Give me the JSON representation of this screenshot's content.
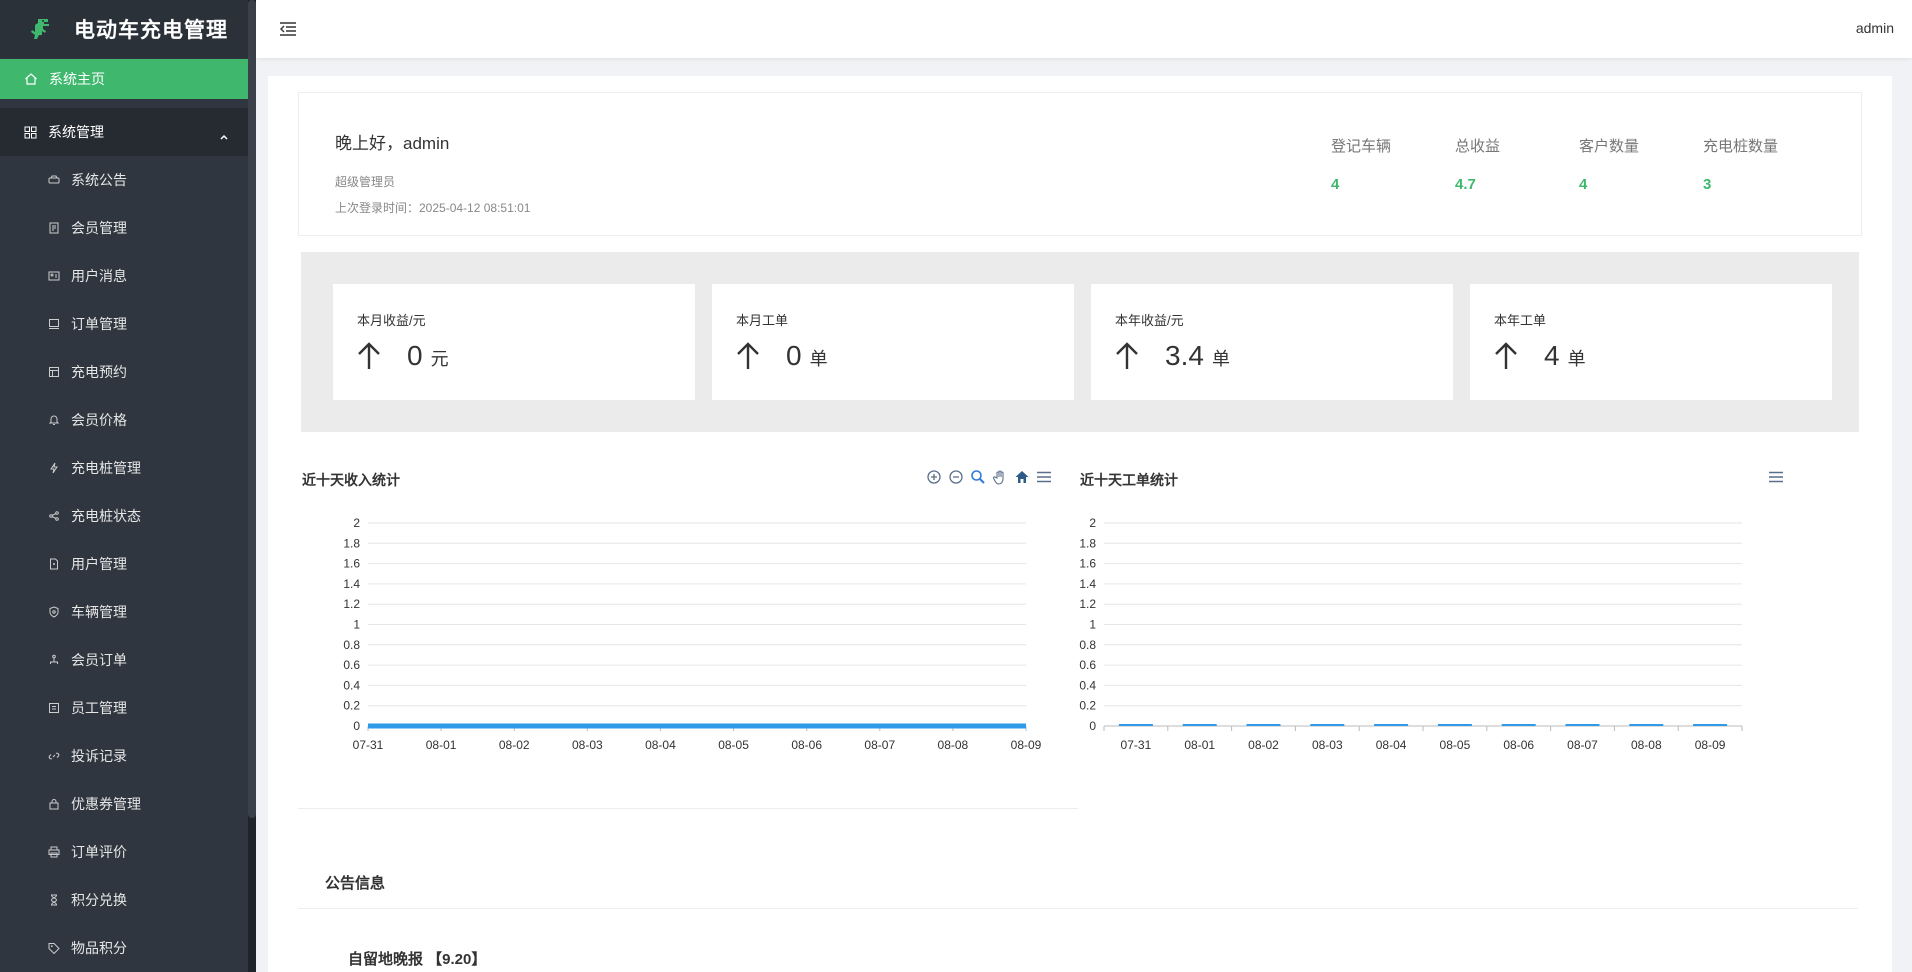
{
  "app": {
    "title": "电动车充电管理",
    "logo_icon": "dinosaur-logo-icon",
    "accent_color": "#3fb86e"
  },
  "sidebar": {
    "home": {
      "label": "系统主页",
      "icon": "home-icon"
    },
    "group": {
      "label": "系统管理",
      "icon": "grid-icon"
    },
    "items": [
      {
        "label": "系统公告",
        "icon": "car-icon"
      },
      {
        "label": "会员管理",
        "icon": "document-icon"
      },
      {
        "label": "用户消息",
        "icon": "id-card-icon"
      },
      {
        "label": "订单管理",
        "icon": "monitor-icon"
      },
      {
        "label": "充电预约",
        "icon": "layout-icon"
      },
      {
        "label": "会员价格",
        "icon": "bell-icon"
      },
      {
        "label": "充电桩管理",
        "icon": "lightning-icon"
      },
      {
        "label": "充电桩状态",
        "icon": "share-icon"
      },
      {
        "label": "用户管理",
        "icon": "file-icon"
      },
      {
        "label": "车辆管理",
        "icon": "shield-icon"
      },
      {
        "label": "会员订单",
        "icon": "network-icon"
      },
      {
        "label": "员工管理",
        "icon": "report-icon"
      },
      {
        "label": "投诉记录",
        "icon": "link-icon"
      },
      {
        "label": "优惠券管理",
        "icon": "lock-icon"
      },
      {
        "label": "订单评价",
        "icon": "printer-icon"
      },
      {
        "label": "积分兑换",
        "icon": "hourglass-icon"
      },
      {
        "label": "物品积分",
        "icon": "tag-icon"
      }
    ]
  },
  "header": {
    "menu_icon": "menu-toggle-icon",
    "user": "admin"
  },
  "welcome": {
    "greeting": "晚上好，admin",
    "role": "超级管理员",
    "last_login": "上次登录时间：2025-04-12 08:51:01",
    "stats": [
      {
        "label": "登记车辆",
        "value": "4"
      },
      {
        "label": "总收益",
        "value": "4.7"
      },
      {
        "label": "客户数量",
        "value": "4"
      },
      {
        "label": "充电桩数量",
        "value": "3"
      }
    ]
  },
  "cards": [
    {
      "label": "本月收益/元",
      "value": "0",
      "unit": "元"
    },
    {
      "label": "本月工单",
      "value": "0",
      "unit": "单"
    },
    {
      "label": "本年收益/元",
      "value": "3.4",
      "unit": "单"
    },
    {
      "label": "本年工单",
      "value": "4",
      "unit": "单"
    }
  ],
  "chart_data": [
    {
      "type": "area",
      "title": "近十天收入统计",
      "categories": [
        "07-31",
        "08-01",
        "08-02",
        "08-03",
        "08-04",
        "08-05",
        "08-06",
        "08-07",
        "08-08",
        "08-09"
      ],
      "values": [
        0,
        0,
        0,
        0,
        0,
        0,
        0,
        0,
        0,
        0
      ],
      "ylim": [
        0,
        2
      ],
      "yticks": [
        "0",
        "0.2",
        "0.4",
        "0.6",
        "0.8",
        "1",
        "1.2",
        "1.4",
        "1.6",
        "1.8",
        "2"
      ],
      "grid": true,
      "color": "#2f9be8",
      "tools": [
        "zoom-in-icon",
        "zoom-out-icon",
        "magnifier-icon",
        "hand-pan-icon",
        "home-reset-icon",
        "hamburger-menu-icon"
      ]
    },
    {
      "type": "bar",
      "title": "近十天工单统计",
      "categories": [
        "07-31",
        "08-01",
        "08-02",
        "08-03",
        "08-04",
        "08-05",
        "08-06",
        "08-07",
        "08-08",
        "08-09"
      ],
      "values": [
        0,
        0,
        0,
        0,
        0,
        0,
        0,
        0,
        0,
        0
      ],
      "ylim": [
        0,
        2
      ],
      "yticks": [
        "0",
        "0.2",
        "0.4",
        "0.6",
        "0.8",
        "1",
        "1.2",
        "1.4",
        "1.6",
        "1.8",
        "2"
      ],
      "grid": true,
      "color": "#2f9be8",
      "tools": [
        "hamburger-menu-icon"
      ]
    }
  ],
  "notices": {
    "title": "公告信息",
    "items": [
      {
        "title": "自留地晚报 【9.20】"
      }
    ]
  }
}
